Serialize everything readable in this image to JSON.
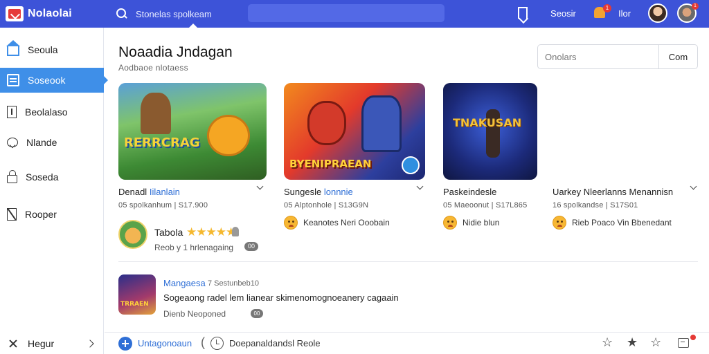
{
  "app": {
    "name": "Nolaolai"
  },
  "topbar": {
    "search_placeholder": "Stonelas spolkeam",
    "link_1": "Seosir",
    "link_2": "Ilor",
    "bell_badge": "1",
    "avatar_badge": "1",
    "icons": [
      "search-icon",
      "bookmark-icon",
      "bell-icon",
      "avatar"
    ]
  },
  "sidebar": {
    "items": [
      {
        "label": "Seoula",
        "icon": "home-icon"
      },
      {
        "label": "Soseook",
        "icon": "list-icon"
      },
      {
        "label": "Beolalaso",
        "icon": "document-icon"
      },
      {
        "label": "Nlande",
        "icon": "heart-icon"
      },
      {
        "label": "Soseda",
        "icon": "lock-icon"
      },
      {
        "label": "Rooper",
        "icon": "tool-icon"
      }
    ],
    "footer": "Hegur"
  },
  "main": {
    "title": "Noaadia Jndagan",
    "subtitle": "Aodbaoe nlotaess",
    "filter_placeholder": "Onolars",
    "filter_button": "Com",
    "cards": [
      {
        "art_text": "RERRCRAG",
        "title_a": "Denadl",
        "title_b": "Iilanlain",
        "meta": "05 spolkanhum | S17.900",
        "extra": ""
      },
      {
        "art_text": "BYENIPRAEAN",
        "title_a": "Sungesle",
        "title_b": "lonnnie",
        "meta": "05 Alptonhole | S13G9N",
        "extra": "Keanotes Neri Ooobain"
      },
      {
        "art_text": "TNAKUSAN",
        "title_a": "Paskeindesle",
        "title_b": "",
        "meta": "05 Maeoonut | S17L865",
        "extra": "Nidie blun"
      },
      {
        "art_text": "",
        "title_a": "Uarkey Nleerlanns Menannisn",
        "title_b": "",
        "meta": "16 spolkandse | S17S01",
        "extra": "Rieb Poaco Vin Bbenedant"
      }
    ],
    "rating": {
      "label": "Tabola",
      "stars": "★★★★★",
      "sub": "Reob  y 1 hrlenagaing",
      "badge": "00"
    },
    "post": {
      "thumb_text": "TRRAEN",
      "author": "Mangaesa",
      "time": "7 Sestunbeb10",
      "body": "Sogeaong radel lem lianear skimenomognoeanery cagaain",
      "meta": "Dienb  Neoponed",
      "badge": "00"
    }
  },
  "footer": {
    "action_1": "Untagonoaun",
    "action_2": "Doepanaldandsl Reole"
  }
}
